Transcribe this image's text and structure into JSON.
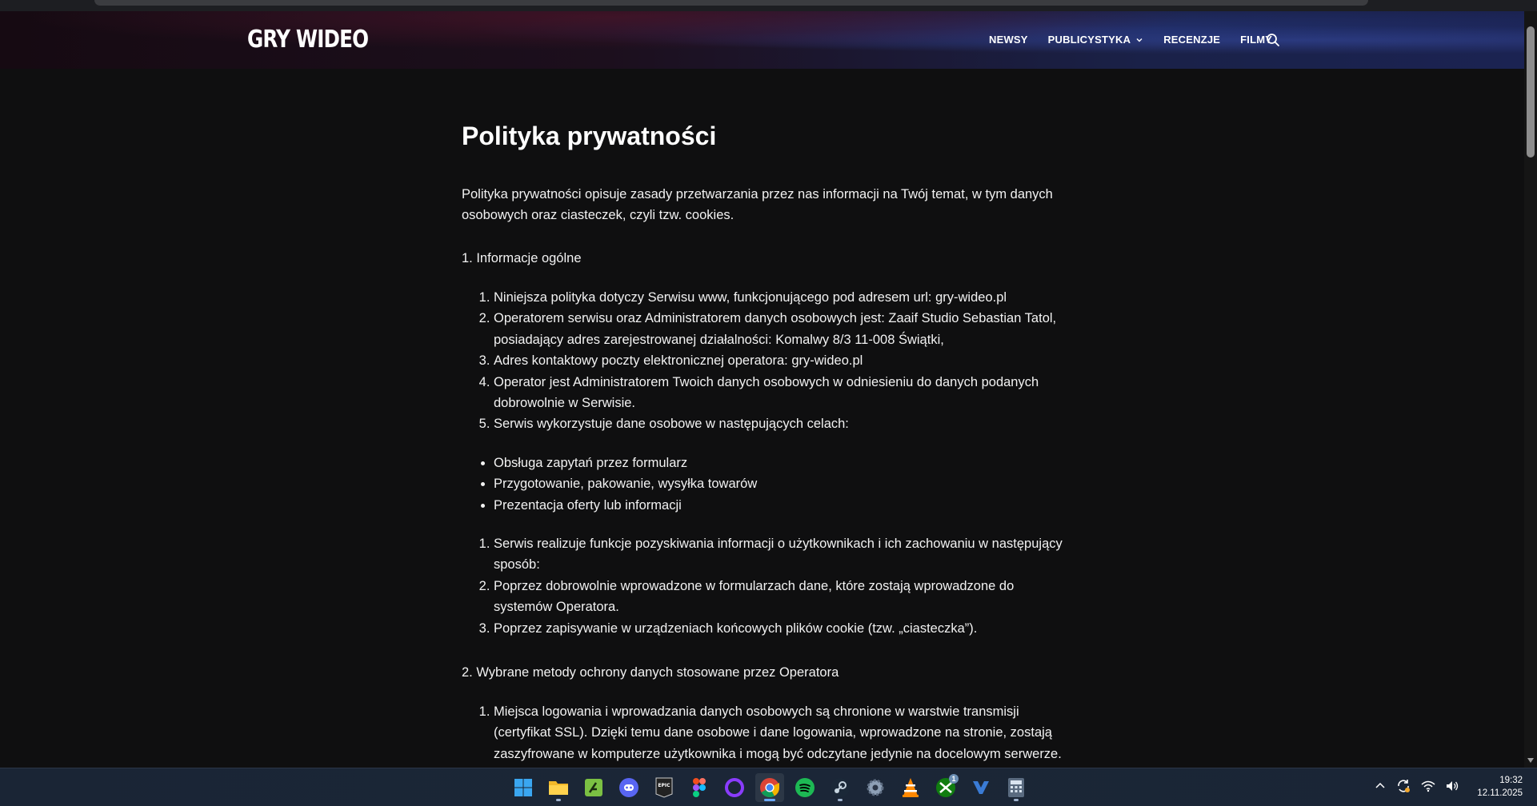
{
  "header": {
    "logo": "GRY WIDEO",
    "nav": [
      {
        "label": "NEWSY"
      },
      {
        "label": "PUBLICYSTYKA",
        "has_dropdown": true
      },
      {
        "label": "RECENZJE"
      },
      {
        "label": "FILMY"
      }
    ]
  },
  "page": {
    "title": "Polityka prywatności",
    "intro": "Polityka prywatności opisuje zasady przetwarzania przez nas informacji na Twój temat, w tym danych osobowych oraz ciasteczek, czyli tzw. cookies.",
    "section1_title": "1. Informacje ogólne",
    "section1_items": [
      "Niniejsza polityka dotyczy Serwisu www, funkcjonującego pod adresem url: gry-wideo.pl",
      "Operatorem serwisu oraz Administratorem danych osobowych jest: Zaaif Studio Sebastian Tatol, posiadający adres zarejestrowanej działalności: Komalwy 8/3 11-008 Świątki,",
      "Adres kontaktowy poczty elektronicznej operatora: gry-wideo.pl",
      "Operator jest Administratorem Twoich danych osobowych w odniesieniu do danych podanych dobrowolnie w Serwisie.",
      "Serwis wykorzystuje dane osobowe w następujących celach:"
    ],
    "purposes": [
      "Obsługa zapytań przez formularz",
      "Przygotowanie, pakowanie, wysyłka towarów",
      "Prezentacja oferty lub informacji"
    ],
    "collection_items": [
      "Serwis realizuje funkcje pozyskiwania informacji o użytkownikach i ich zachowaniu w następujący sposób:",
      "Poprzez dobrowolnie wprowadzone w formularzach dane, które zostają wprowadzone do systemów Operatora.",
      "Poprzez zapisywanie w urządzeniach końcowych plików cookie (tzw. „ciasteczka”)."
    ],
    "section2_title": "2. Wybrane metody ochrony danych stosowane przez Operatora",
    "section2_items": [
      "Miejsca logowania i wprowadzania danych osobowych są chronione w warstwie transmisji (certyfikat SSL). Dzięki temu dane osobowe i dane logowania, wprowadzone na stronie, zostają zaszyfrowane w komputerze użytkownika i mogą być odczytane jedynie na docelowym serwerze."
    ]
  },
  "taskbar": {
    "apps": [
      "start",
      "file-explorer",
      "app-a",
      "discord",
      "epic-games",
      "figma",
      "app-circle",
      "chrome",
      "spotify",
      "steam",
      "settings",
      "vlc",
      "xbox",
      "app-blue",
      "calculator"
    ],
    "xbox_badge": "1",
    "time": "19:32",
    "date": "12.11.2025"
  },
  "colors": {
    "background": "#0f0f10",
    "text": "#f2f2f2",
    "taskbar": "#1a2535"
  }
}
